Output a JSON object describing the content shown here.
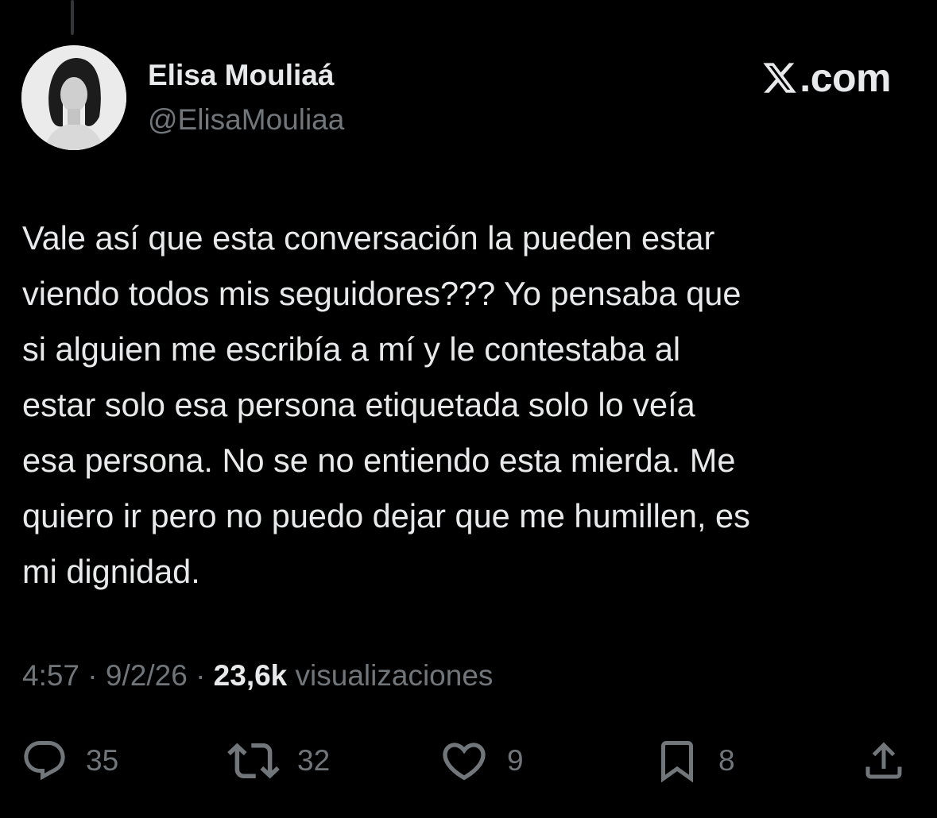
{
  "author": {
    "display_name": "Elisa Mouliaá",
    "handle": "@ElisaMouliaa"
  },
  "brand": {
    "text": ".com"
  },
  "tweet": {
    "text": "Vale así que esta conversación la pueden estar\nviendo todos mis seguidores??? Yo pensaba que\nsi alguien me escribía a mí y le contestaba al\nestar solo esa persona etiquetada solo lo veía\nesa persona. No se no entiendo esta mierda. Me\nquiero ir pero no puedo dejar que me humillen, es\nmi dignidad."
  },
  "meta": {
    "time": "4:57",
    "separator": "·",
    "date": "9/2/26",
    "views_count": "23,6k",
    "views_label": "visualizaciones"
  },
  "actions": {
    "replies": "35",
    "reposts": "32",
    "likes": "9",
    "bookmarks": "8"
  },
  "icons": {
    "reply": "reply-icon",
    "repost": "repost-icon",
    "like": "heart-icon",
    "bookmark": "bookmark-icon",
    "share": "share-icon",
    "brand": "x-logo-icon"
  },
  "colors": {
    "background": "#000000",
    "primary_text": "#e7e9ea",
    "secondary_text": "#71767b"
  }
}
